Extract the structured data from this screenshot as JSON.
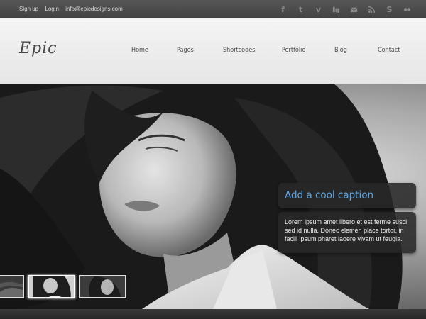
{
  "topbar": {
    "links": [
      "Sign up",
      "Login",
      "info@epicdesigns.com"
    ],
    "social_icons": [
      "facebook-icon",
      "twitter-icon",
      "vimeo-icon",
      "digg-icon",
      "email-icon",
      "rss-icon",
      "skype-icon",
      "flickr-icon"
    ]
  },
  "header": {
    "logo": "Epic",
    "nav": [
      "Home",
      "Pages",
      "Shortcodes",
      "Portfolio",
      "Blog",
      "Contact"
    ]
  },
  "slider": {
    "caption_title": "Add a cool caption",
    "caption_text": "Lorem ipsum amet libero et est ferme susci sed id nulla. Donec elemen place tortor, in facili ipsum pharet laoere vivam ut feugia.",
    "thumbnails": [
      "thumbnail-1",
      "thumbnail-2",
      "thumbnail-3"
    ],
    "active_thumbnail": 1
  },
  "colors": {
    "topbar": "#4a4a4a",
    "header": "#eeeeee",
    "caption_title": "#5aa6e6",
    "caption_bg": "#282828"
  }
}
